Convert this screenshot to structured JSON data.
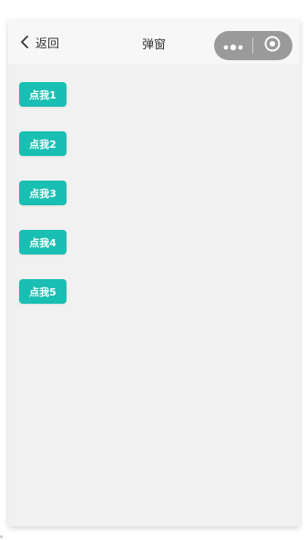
{
  "navbar": {
    "back_label": "返回",
    "title": "弹窗",
    "back_icon": "chevron-left-icon",
    "menu_icon": "more-dots-icon",
    "close_icon": "target-circle-icon"
  },
  "buttons": [
    {
      "label": "点我1"
    },
    {
      "label": "点我2"
    },
    {
      "label": "点我3"
    },
    {
      "label": "点我4"
    },
    {
      "label": "点我5"
    }
  ],
  "colors": {
    "accent": "#19bfb2",
    "page_bg": "#f1f1f1",
    "navbar_bg": "#f7f7f7",
    "capsule_bg": "#9a9a9a"
  }
}
